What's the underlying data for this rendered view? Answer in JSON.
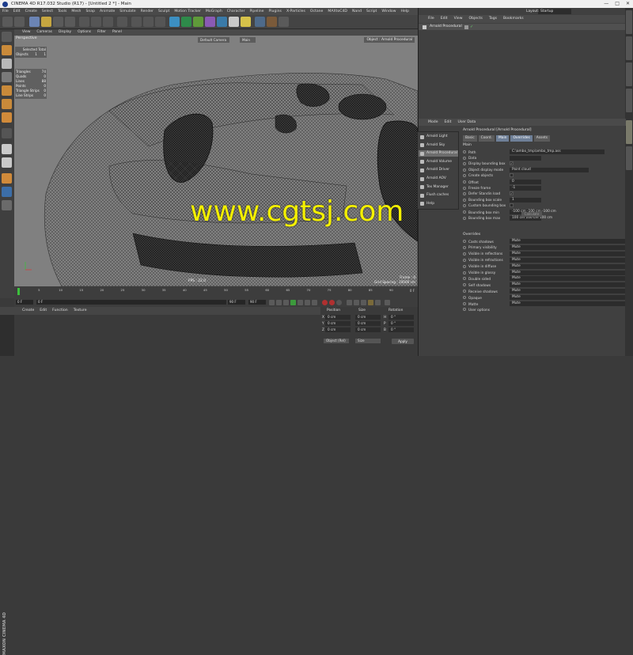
{
  "window": {
    "title": "CINEMA 4D R17.032 Studio (R17) - [Untitled 2 *] - Main",
    "controls": [
      "—",
      "□",
      "✕"
    ]
  },
  "menubar": [
    "File",
    "Edit",
    "Create",
    "Select",
    "Tools",
    "Mesh",
    "Snap",
    "Animate",
    "Simulate",
    "Render",
    "Sculpt",
    "Motion Tracker",
    "MoGraph",
    "Character",
    "Pipeline",
    "Plugins",
    "X-Particles",
    "Octane",
    "MAXtoC4D",
    "Nand",
    "Script",
    "Window",
    "Help"
  ],
  "layout": {
    "label": "Layout:",
    "value": "Startup"
  },
  "viewport": {
    "menu": [
      "View",
      "Cameras",
      "Display",
      "Options",
      "Filter",
      "Panel"
    ],
    "label": "Perspective",
    "camera": "Default Camera",
    "render_mode": "Main",
    "object_label": "Object : Arnold Procedural",
    "hud": {
      "header": "Selected Total",
      "objects_label": "Objects",
      "objects_sel": "1",
      "objects_total": "1",
      "stats": [
        {
          "label": "Triangles",
          "value": "74"
        },
        {
          "label": "Quads",
          "value": "0"
        },
        {
          "label": "Lines",
          "value": "88"
        },
        {
          "label": "Points",
          "value": "0"
        },
        {
          "label": "Triangle Strips",
          "value": "0"
        },
        {
          "label": "Line Strips",
          "value": "0"
        }
      ]
    },
    "fps": "FPS : 22.0",
    "frame": "Frame : 0",
    "grid_spacing": "Grid Spacing : 10000 cm",
    "watermark": "www.cgtsj.com"
  },
  "timeline": {
    "ticks": [
      "0",
      "5",
      "10",
      "15",
      "20",
      "25",
      "30",
      "35",
      "40",
      "45",
      "50",
      "55",
      "60",
      "65",
      "70",
      "75",
      "80",
      "85",
      "90"
    ],
    "end_tick": "0 F",
    "start_field": "0 F",
    "current_field": "0 F",
    "end_field": "90 F",
    "max_field": "90 F"
  },
  "material_manager": {
    "menu": [
      "Create",
      "Edit",
      "Function",
      "Texture"
    ],
    "brand": "MAXON CINEMA 4D"
  },
  "coordinates": {
    "headers": [
      "Position",
      "Size",
      "Rotation"
    ],
    "rows": [
      {
        "axis": "X",
        "pos": "0 cm",
        "size": "0 cm",
        "rot_axis": "H",
        "rot": "0 °"
      },
      {
        "axis": "Y",
        "pos": "0 cm",
        "size": "0 cm",
        "rot_axis": "P",
        "rot": "0 °"
      },
      {
        "axis": "Z",
        "pos": "0 cm",
        "size": "0 cm",
        "rot_axis": "B",
        "rot": "0 °"
      }
    ],
    "mode": "Object (Rel)",
    "size_mode": "Size",
    "apply": "Apply"
  },
  "object_manager": {
    "menu": [
      "File",
      "Edit",
      "View",
      "Objects",
      "Tags",
      "Bookmarks"
    ],
    "objects": [
      {
        "name": "Arnold Procedural"
      }
    ]
  },
  "attributes": {
    "menu": [
      "Mode",
      "Edit",
      "User Data"
    ],
    "title": "Arnold Procedural [Arnold Procedural]",
    "tabs": [
      {
        "label": "Basic"
      },
      {
        "label": "Coord."
      },
      {
        "label": "Main",
        "active": true
      },
      {
        "label": "Overrides",
        "active": true
      },
      {
        "label": "Assets"
      }
    ],
    "main_label": "Main",
    "main_rows": [
      {
        "label": "Path",
        "value": "C:\\ambo_tmp\\ambo_tmp.ass"
      },
      {
        "label": "Data",
        "value": ""
      },
      {
        "label": "Display bounding box",
        "value": "✓"
      },
      {
        "label": "Object display mode",
        "value": "Point cloud"
      },
      {
        "label": "Create objects",
        "value": ""
      },
      {
        "label": "Offset",
        "value": "0"
      },
      {
        "label": "Freeze frame",
        "value": "-1"
      },
      {
        "label": "Defer Standin load",
        "value": "✓"
      },
      {
        "label": "Bounding box scale",
        "value": "1"
      },
      {
        "label": "Custom bounding box",
        "value": ""
      },
      {
        "label": "Bounding box min",
        "value": "-100 cm   -100 cm   -100 cm"
      },
      {
        "label": "Bounding box max",
        "value": "100 cm   100 cm   100 cm"
      }
    ],
    "calculate": "Calculate",
    "overrides_label": "Overrides",
    "override_rows": [
      {
        "label": "Casts shadows",
        "value": "Mute"
      },
      {
        "label": "Primary visibility",
        "value": "Mute"
      },
      {
        "label": "Visible in reflections",
        "value": "Mute"
      },
      {
        "label": "Visible in refractions",
        "value": "Mute"
      },
      {
        "label": "Visible in diffuse",
        "value": "Mute"
      },
      {
        "label": "Visible in glossy",
        "value": "Mute"
      },
      {
        "label": "Double sided",
        "value": "Mute"
      },
      {
        "label": "Self shadows",
        "value": "Mute"
      },
      {
        "label": "Receive shadows",
        "value": "Mute"
      },
      {
        "label": "Opaque",
        "value": "Mute"
      },
      {
        "label": "Matte",
        "value": "Mute"
      },
      {
        "label": "User options",
        "value": ""
      }
    ]
  },
  "arnold_menu": [
    {
      "label": "Arnold Light"
    },
    {
      "label": "Arnold Sky"
    },
    {
      "label": "Arnold Procedural"
    },
    {
      "label": "Arnold Volume"
    },
    {
      "label": "Arnold Driver"
    },
    {
      "label": "Arnold AOV"
    },
    {
      "label": "Tex Manager"
    },
    {
      "label": "Flush caches"
    },
    {
      "label": "Help"
    }
  ],
  "colors": {
    "accent": "#6e7f97",
    "viewport": "#808080",
    "watermark": "#f4f000"
  }
}
